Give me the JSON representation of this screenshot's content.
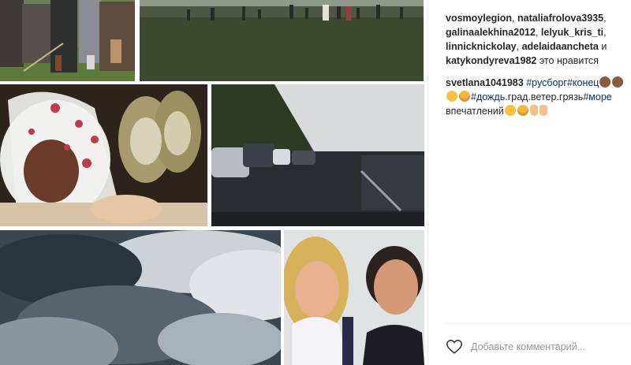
{
  "likes": {
    "users": [
      "vosmoylegion",
      "nataliafrolova3935",
      "galinaalekhina2012",
      "lelyuk_kris_ti",
      "linnicknickolay",
      "adelaidaancheta",
      "katykondyreva1982"
    ],
    "separator": ", ",
    "conjunction": " и ",
    "suffix": " это нравится"
  },
  "caption": {
    "author": "svetlana1041983",
    "tag1": "#русборг",
    "tag2": "#конец",
    "tag3": "#дождь",
    "text1": ".град.ветер.грязь",
    "tag4": "#море",
    "text2": "впечатлений"
  },
  "comment": {
    "placeholder": "Добавьте комментарий..."
  },
  "photos": [
    {
      "name": "knights-photo"
    },
    {
      "name": "festival-field-photo"
    },
    {
      "name": "shoes-photo"
    },
    {
      "name": "parked-cars-photo"
    },
    {
      "name": "storm-clouds-photo"
    },
    {
      "name": "selfie-photo"
    }
  ],
  "icons": {
    "like": "heart-outline-icon"
  },
  "colors": {
    "text": "#262626",
    "hashtag": "#003569",
    "placeholder": "#999999",
    "divider": "#efefef"
  }
}
